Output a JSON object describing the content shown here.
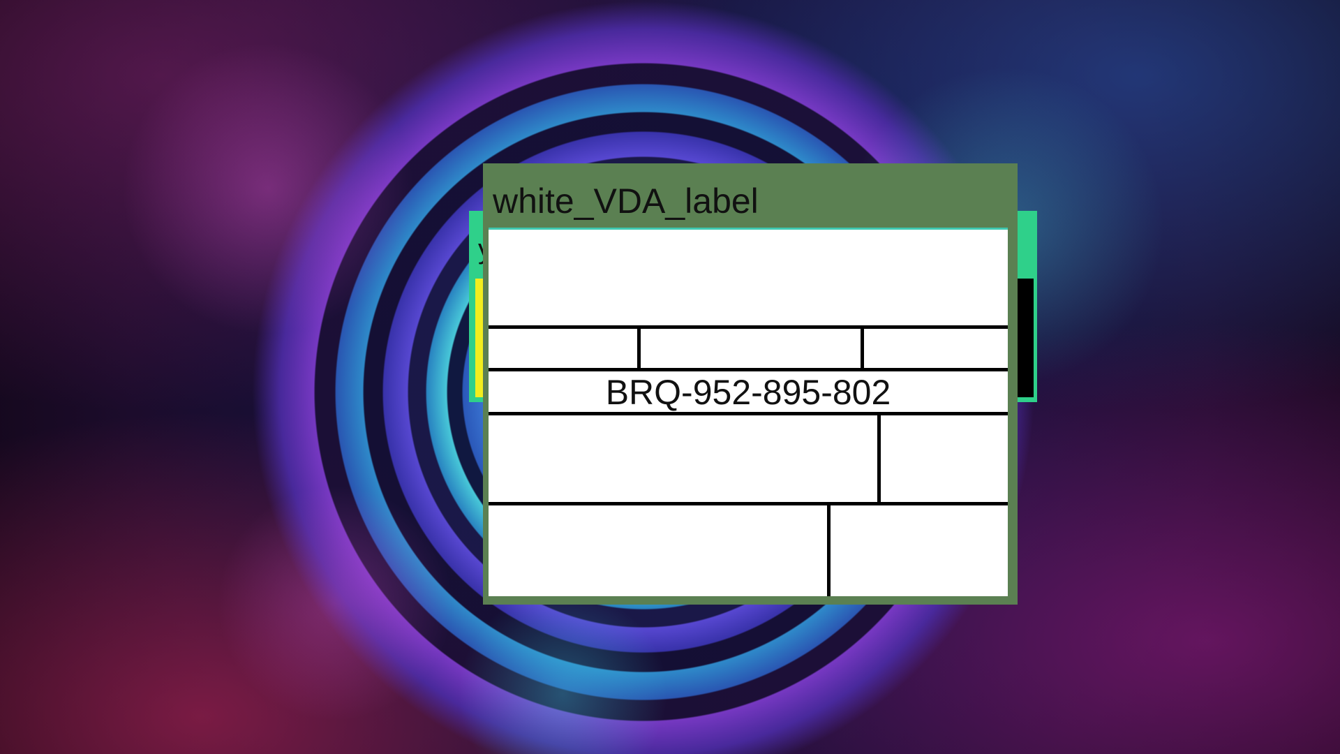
{
  "desktop": {
    "background_colors": {
      "base": "#0c0918",
      "accent_cyan": "#39c4d8",
      "accent_magenta": "#c83ab8"
    }
  },
  "background_window": {
    "title_fragment": "y",
    "frame_color": "#2fd08a"
  },
  "label_window": {
    "title": "white_VDA_label",
    "frame_color": "#5b8052",
    "serial_number": "BRQ-952-895-802"
  }
}
